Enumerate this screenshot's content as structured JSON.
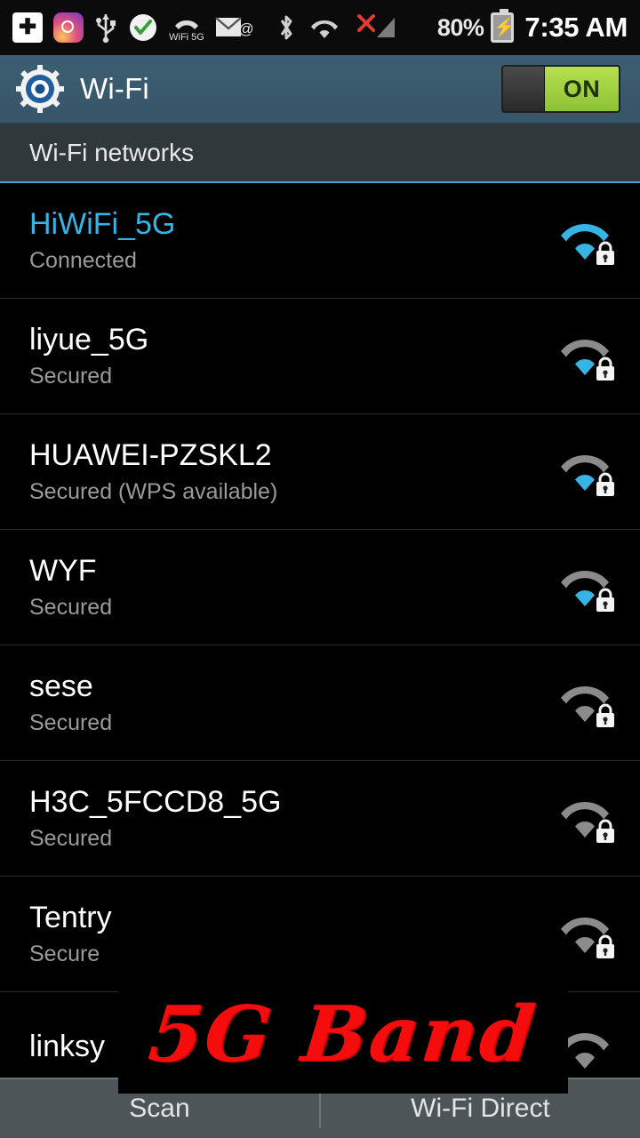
{
  "status_bar": {
    "icons": [
      "add-icon",
      "instagram-icon",
      "usb-icon",
      "checkmark-icon",
      "wifi-5g-icon",
      "email-icon",
      "bluetooth-icon",
      "wifi-icon",
      "no-sim-icon",
      "signal-icon"
    ],
    "battery_percent": "80%",
    "time": "7:35 AM"
  },
  "action_bar": {
    "icon": "settings-gear-icon",
    "title": "Wi-Fi",
    "toggle_label": "ON",
    "toggle_state": "on",
    "accent_color": "#8dc236"
  },
  "section": {
    "header": "Wi-Fi networks",
    "underline_color": "#4aa3c7"
  },
  "networks": [
    {
      "ssid": "HiWiFi_5G",
      "status": "Connected",
      "connected": true,
      "signal": 4,
      "secured": true
    },
    {
      "ssid": "liyue_5G",
      "status": "Secured",
      "connected": false,
      "signal": 3,
      "secured": true
    },
    {
      "ssid": "HUAWEI-PZSKL2",
      "status": "Secured (WPS available)",
      "connected": false,
      "signal": 3,
      "secured": true
    },
    {
      "ssid": "WYF",
      "status": "Secured",
      "connected": false,
      "signal": 3,
      "secured": true
    },
    {
      "ssid": "sese",
      "status": "Secured",
      "connected": false,
      "signal": 2,
      "secured": true
    },
    {
      "ssid": "H3C_5FCCD8_5G",
      "status": "Secured",
      "connected": false,
      "signal": 2,
      "secured": true
    },
    {
      "ssid": "Tentry",
      "status": "Secure",
      "connected": false,
      "signal": 2,
      "secured": true
    },
    {
      "ssid": "linksy",
      "status": "",
      "connected": false,
      "signal": 2,
      "secured": true
    }
  ],
  "bottom_bar": {
    "scan_label": "Scan",
    "wps_label": "Wi-Fi Direct"
  },
  "annotation": {
    "text": "5G Band",
    "color": "#f50d0d"
  }
}
